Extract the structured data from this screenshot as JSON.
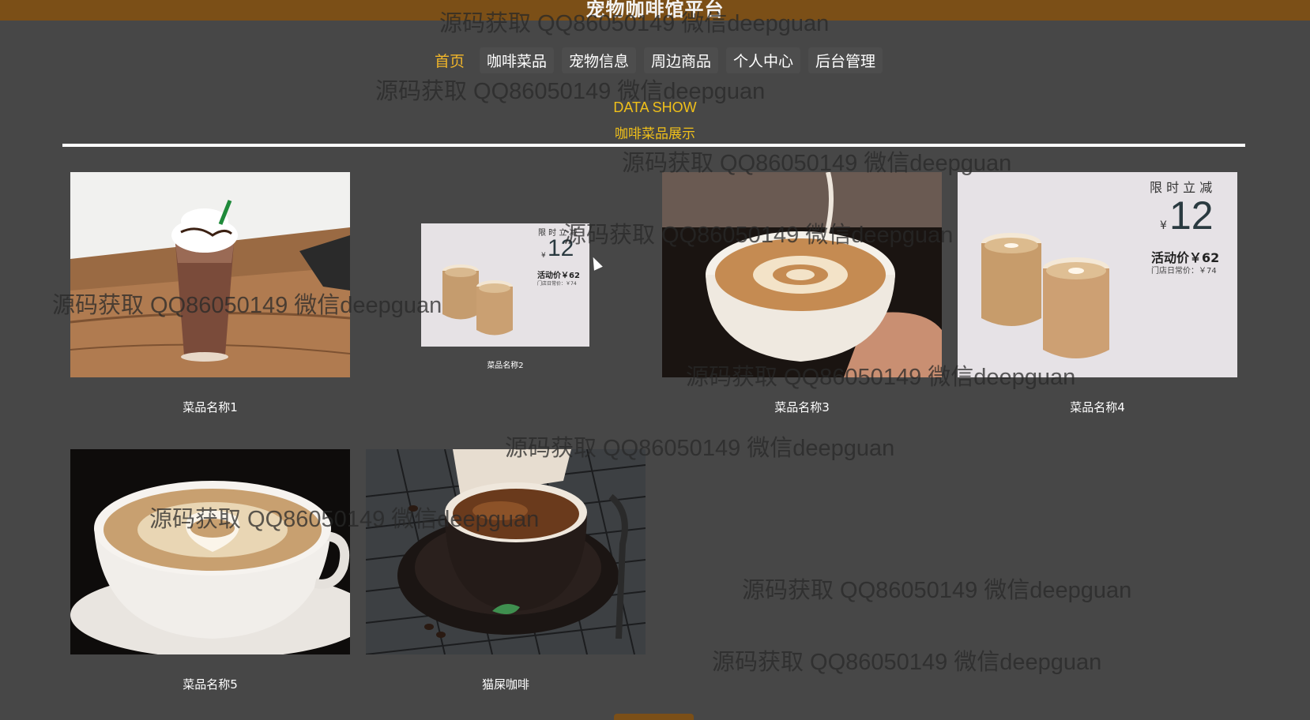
{
  "site": {
    "title": "宠物咖啡馆平台"
  },
  "nav": [
    {
      "label": "首页",
      "active": true
    },
    {
      "label": "咖啡菜品"
    },
    {
      "label": "宠物信息"
    },
    {
      "label": "周边商品"
    },
    {
      "label": "个人中心"
    },
    {
      "label": "后台管理"
    }
  ],
  "section": {
    "title_en": "DATA SHOW",
    "title_cn": "咖啡菜品展示"
  },
  "products": [
    {
      "name": "菜品名称1"
    },
    {
      "name": "菜品名称2",
      "promo": {
        "top": "限 时 立 减",
        "currency": "¥",
        "price": "12",
        "deal": "活动价￥62",
        "regular": "门店日常价：￥74"
      }
    },
    {
      "name": "菜品名称3"
    },
    {
      "name": "菜品名称4",
      "promo": {
        "top": "限 时 立 减",
        "currency": "¥",
        "price": "12",
        "deal": "活动价￥62",
        "regular": "门店日常价：￥74"
      }
    },
    {
      "name": "菜品名称5"
    },
    {
      "name": "猫屎咖啡"
    }
  ],
  "watermark": "源码获取 QQ86050149 微信deepguan",
  "colors": {
    "header": "#7b4f17",
    "accent": "#f0c01a",
    "background": "#474747"
  }
}
